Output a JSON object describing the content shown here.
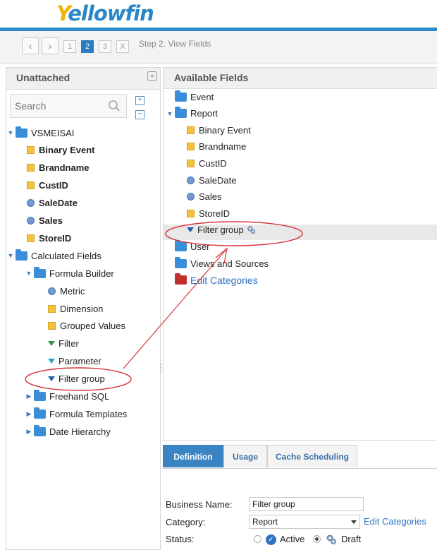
{
  "app": {
    "logo_y": "Y",
    "logo_rest": "ellowfin"
  },
  "wizard": {
    "prev_icon": "chevron-left",
    "next_icon": "chevron-right",
    "steps": [
      "1",
      "2",
      "3",
      "X"
    ],
    "active_step": "2",
    "step_label": "Step 2. View Fields"
  },
  "unattached": {
    "title": "Unattached",
    "collapse_label": "«",
    "search_placeholder": "Search",
    "expand_all": "+",
    "collapse_all": "−",
    "tree": [
      {
        "label": "VSMEISAI",
        "icon": "folder",
        "arrow": "▼",
        "level": 0,
        "bold": false
      },
      {
        "label": "Binary Event",
        "icon": "dimension",
        "level": 1,
        "bold": true
      },
      {
        "label": "Brandname",
        "icon": "dimension",
        "level": 1,
        "bold": true
      },
      {
        "label": "CustID",
        "icon": "dimension",
        "level": 1,
        "bold": true
      },
      {
        "label": "SaleDate",
        "icon": "metric",
        "level": 1,
        "bold": true
      },
      {
        "label": "Sales",
        "icon": "metric",
        "level": 1,
        "bold": true
      },
      {
        "label": "StoreID",
        "icon": "dimension",
        "level": 1,
        "bold": true
      },
      {
        "label": "Calculated Fields",
        "icon": "folder",
        "arrow": "▼",
        "level": 0,
        "bold": false
      },
      {
        "label": "Formula Builder",
        "icon": "folder",
        "arrow": "▼",
        "level": 1,
        "bold": false
      },
      {
        "label": "Metric",
        "icon": "metric",
        "level": 2,
        "bold": false
      },
      {
        "label": "Dimension",
        "icon": "dimension",
        "level": 2,
        "bold": false
      },
      {
        "label": "Grouped Values",
        "icon": "dimension",
        "level": 2,
        "bold": false
      },
      {
        "label": "Filter",
        "icon": "filter-green",
        "level": 2,
        "bold": false
      },
      {
        "label": "Parameter",
        "icon": "filter-teal",
        "level": 2,
        "bold": false
      },
      {
        "label": "Filter group",
        "icon": "filter-blue",
        "level": 2,
        "bold": false
      },
      {
        "label": "Freehand SQL",
        "icon": "folder",
        "arrow": "▶",
        "level": 1,
        "bold": false
      },
      {
        "label": "Formula Templates",
        "icon": "folder",
        "arrow": "▶",
        "level": 1,
        "bold": false
      },
      {
        "label": "Date Hierarchy",
        "icon": "folder",
        "arrow": "▶",
        "level": 1,
        "bold": false
      }
    ]
  },
  "available": {
    "title": "Available Fields",
    "tree": [
      {
        "label": "Event",
        "icon": "folder"
      },
      {
        "label": "Report",
        "icon": "folder",
        "arrow": "▼"
      },
      {
        "label": "Binary Event",
        "icon": "dimension"
      },
      {
        "label": "Brandname",
        "icon": "dimension"
      },
      {
        "label": "CustID",
        "icon": "dimension"
      },
      {
        "label": "SaleDate",
        "icon": "metric"
      },
      {
        "label": "Sales",
        "icon": "metric"
      },
      {
        "label": "StoreID",
        "icon": "dimension"
      },
      {
        "label": "Filter group",
        "icon": "filter-blue",
        "extra_icon": "gear"
      },
      {
        "label": "User",
        "icon": "folder"
      },
      {
        "label": "Views and Sources",
        "icon": "folder"
      },
      {
        "label": "Edit Categories",
        "icon": "folder-red",
        "link": true
      }
    ]
  },
  "tabs": [
    {
      "label": "Definition",
      "active": true
    },
    {
      "label": "Usage",
      "active": false
    },
    {
      "label": "Cache Scheduling",
      "active": false
    }
  ],
  "form": {
    "business_name_label": "Business Name:",
    "business_name_value": "Filter group",
    "category_label": "Category:",
    "category_value": "Report",
    "edit_categories_link": "Edit Categories",
    "status_label": "Status:",
    "status_active": "Active",
    "status_draft": "Draft",
    "selected_status": "Draft"
  },
  "colors": {
    "accent": "#2b8ccc",
    "folder": "#3a8ed8",
    "annotation": "#d9343b",
    "link": "#2a72c2"
  }
}
